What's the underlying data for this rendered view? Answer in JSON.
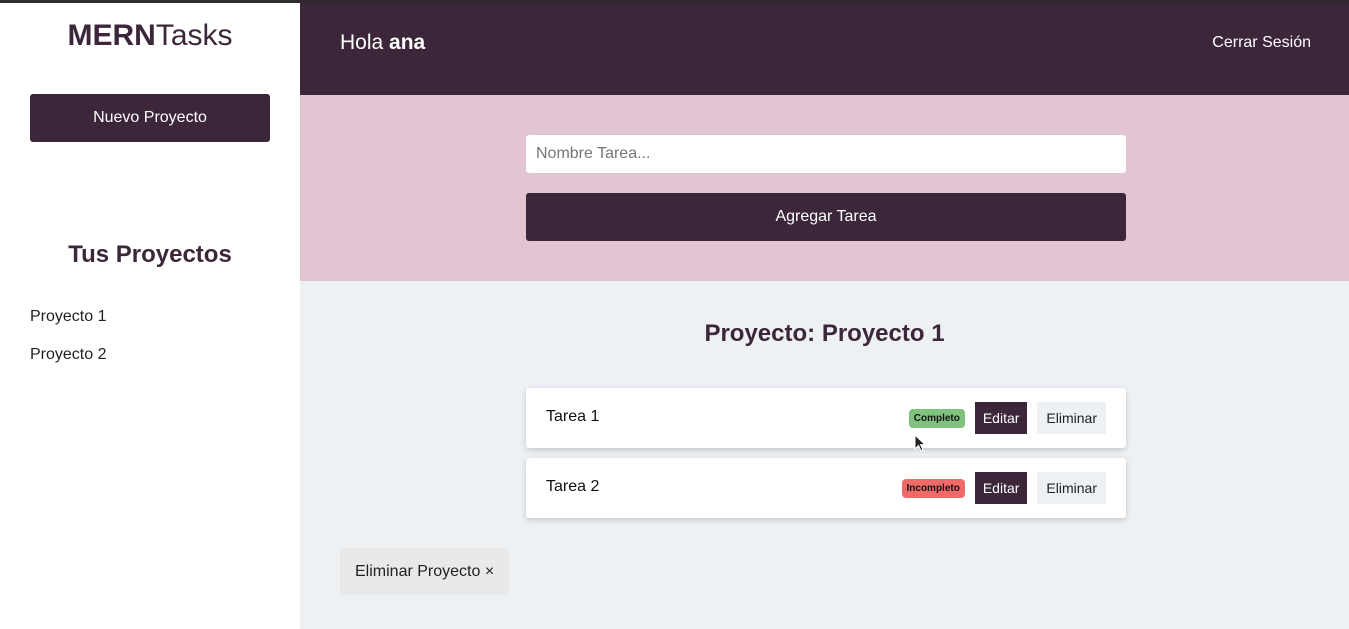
{
  "sidebar": {
    "logo_bold": "MERN",
    "logo_light": "Tasks",
    "new_project_label": "Nuevo Proyecto",
    "projects_title": "Tus Proyectos",
    "projects": [
      {
        "label": "Proyecto 1"
      },
      {
        "label": "Proyecto 2"
      }
    ]
  },
  "header": {
    "greeting": "Hola",
    "user_name": "ana",
    "logout_label": "Cerrar Sesión"
  },
  "form": {
    "task_placeholder": "Nombre Tarea...",
    "task_value": "",
    "add_label": "Agregar Tarea"
  },
  "main": {
    "project_title": "Proyecto: Proyecto 1",
    "tasks": [
      {
        "name": "Tarea 1",
        "status": "Completo",
        "edit_label": "Editar",
        "delete_label": "Eliminar"
      },
      {
        "name": "Tarea 2",
        "status": "Incompleto",
        "edit_label": "Editar",
        "delete_label": "Eliminar"
      }
    ],
    "delete_project_label": "Eliminar Proyecto ×"
  },
  "colors": {
    "primary": "#3c2639",
    "form_bg": "#e2c4d3",
    "tasks_bg": "#edf1f4",
    "complete": "#7fc37f",
    "incomplete": "#f06a6a"
  },
  "icons": [
    "mouse-cursor-icon"
  ]
}
